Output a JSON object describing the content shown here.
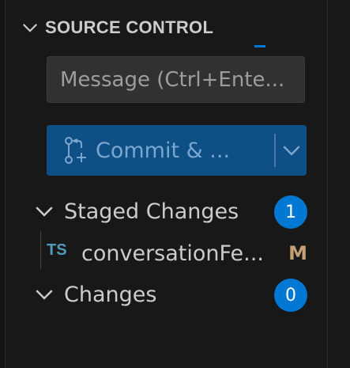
{
  "panel": {
    "title": "SOURCE CONTROL"
  },
  "message": {
    "placeholder": "Message (Ctrl+Ente..."
  },
  "commit": {
    "label": "Commit & ..."
  },
  "staged": {
    "label": "Staged Changes",
    "count": "1"
  },
  "staged_file": {
    "type_icon": "TS",
    "name": "conversationFe...",
    "status": "M"
  },
  "changes": {
    "label": "Changes",
    "count": "0"
  },
  "colors": {
    "accent": "#0078d4",
    "commit_button": "#0e4f85",
    "ts_icon": "#519aba",
    "modified": "#c4a072"
  },
  "icons": [
    "chevron-down-icon",
    "git-commit-icon",
    "chevron-down-icon"
  ]
}
